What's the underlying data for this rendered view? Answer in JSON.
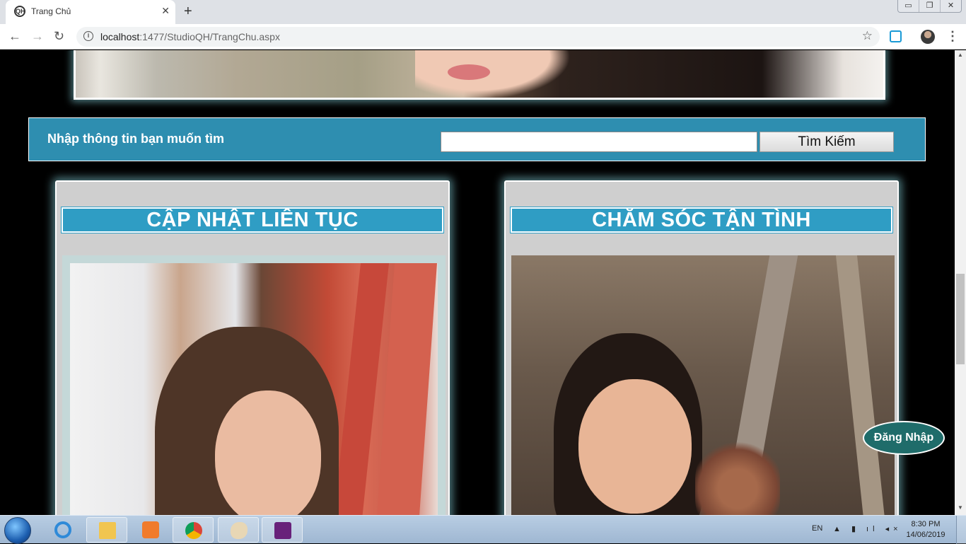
{
  "browser": {
    "tab_title": "Trang Chủ",
    "tab_close": "✕",
    "new_tab": "+",
    "favicon_text": "QH",
    "window_controls": [
      "▭",
      "❐",
      "✕"
    ],
    "url_host": "localhost",
    "url_path": ":1477/StudioQH/TrangChu.aspx",
    "back": "←",
    "forward": "→",
    "reload": "↻",
    "bookmark_star": "☆",
    "menu": "⋮"
  },
  "search": {
    "label": "Nhập thông tin bạn muốn tìm",
    "input_value": "",
    "button_label": "Tìm Kiếm"
  },
  "cards": {
    "left_title": "CẬP NHẬT LIÊN TỤC",
    "right_title": "CHĂM SÓC TẬN TÌNH"
  },
  "login_button": "Đăng Nhập",
  "taskbar": {
    "language": "EN",
    "tray": "▲ ▮ ıl ◂×",
    "time": "8:30 PM",
    "date": "14/06/2019"
  },
  "colors": {
    "accent_blue": "#2e8eb0",
    "title_blue": "#2f9dc4",
    "login_teal": "#1f6c6a",
    "glow": "#8cdce6"
  }
}
